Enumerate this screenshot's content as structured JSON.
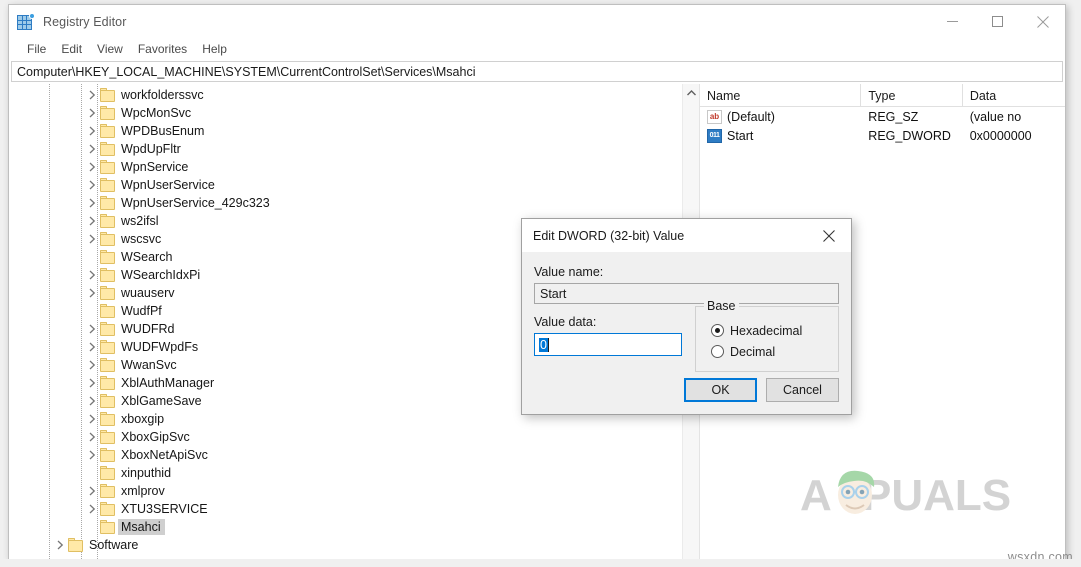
{
  "window": {
    "title": "Registry Editor",
    "icon": "registry-editor-icon",
    "minimize_label": "Minimize",
    "maximize_label": "Maximize",
    "close_label": "Close"
  },
  "menu": {
    "items": [
      {
        "label": "File"
      },
      {
        "label": "Edit"
      },
      {
        "label": "View"
      },
      {
        "label": "Favorites"
      },
      {
        "label": "Help"
      }
    ]
  },
  "address": {
    "value": "Computer\\HKEY_LOCAL_MACHINE\\SYSTEM\\CurrentControlSet\\Services\\Msahci"
  },
  "tree": {
    "items": [
      {
        "label": "workfolderssvc",
        "expandable": true,
        "indent": 1,
        "selected": false
      },
      {
        "label": "WpcMonSvc",
        "expandable": true,
        "indent": 1,
        "selected": false
      },
      {
        "label": "WPDBusEnum",
        "expandable": true,
        "indent": 1,
        "selected": false
      },
      {
        "label": "WpdUpFltr",
        "expandable": true,
        "indent": 1,
        "selected": false
      },
      {
        "label": "WpnService",
        "expandable": true,
        "indent": 1,
        "selected": false
      },
      {
        "label": "WpnUserService",
        "expandable": true,
        "indent": 1,
        "selected": false
      },
      {
        "label": "WpnUserService_429c323",
        "expandable": true,
        "indent": 1,
        "selected": false
      },
      {
        "label": "ws2ifsl",
        "expandable": true,
        "indent": 1,
        "selected": false
      },
      {
        "label": "wscsvc",
        "expandable": true,
        "indent": 1,
        "selected": false
      },
      {
        "label": "WSearch",
        "expandable": false,
        "indent": 1,
        "selected": false
      },
      {
        "label": "WSearchIdxPi",
        "expandable": true,
        "indent": 1,
        "selected": false
      },
      {
        "label": "wuauserv",
        "expandable": true,
        "indent": 1,
        "selected": false
      },
      {
        "label": "WudfPf",
        "expandable": false,
        "indent": 1,
        "selected": false
      },
      {
        "label": "WUDFRd",
        "expandable": true,
        "indent": 1,
        "selected": false
      },
      {
        "label": "WUDFWpdFs",
        "expandable": true,
        "indent": 1,
        "selected": false
      },
      {
        "label": "WwanSvc",
        "expandable": true,
        "indent": 1,
        "selected": false
      },
      {
        "label": "XblAuthManager",
        "expandable": true,
        "indent": 1,
        "selected": false
      },
      {
        "label": "XblGameSave",
        "expandable": true,
        "indent": 1,
        "selected": false
      },
      {
        "label": "xboxgip",
        "expandable": true,
        "indent": 1,
        "selected": false
      },
      {
        "label": "XboxGipSvc",
        "expandable": true,
        "indent": 1,
        "selected": false
      },
      {
        "label": "XboxNetApiSvc",
        "expandable": true,
        "indent": 1,
        "selected": false
      },
      {
        "label": "xinputhid",
        "expandable": false,
        "indent": 1,
        "selected": false
      },
      {
        "label": "xmlprov",
        "expandable": true,
        "indent": 1,
        "selected": false
      },
      {
        "label": "XTU3SERVICE",
        "expandable": true,
        "indent": 1,
        "selected": false
      },
      {
        "label": "Msahci",
        "expandable": false,
        "indent": 1,
        "selected": true
      },
      {
        "label": "Software",
        "expandable": true,
        "indent": 0,
        "selected": false
      }
    ]
  },
  "list": {
    "columns": [
      {
        "label": "Name"
      },
      {
        "label": "Type"
      },
      {
        "label": "Data"
      }
    ],
    "rows": [
      {
        "icon": "string-value-icon",
        "name": "(Default)",
        "type": "REG_SZ",
        "data": "(value no"
      },
      {
        "icon": "dword-value-icon",
        "name": "Start",
        "type": "REG_DWORD",
        "data": "0x0000000"
      }
    ]
  },
  "dialog": {
    "title": "Edit DWORD (32-bit) Value",
    "close_label": "Close",
    "value_name_label": "Value name:",
    "value_name": "Start",
    "value_data_label": "Value data:",
    "value_data": "0",
    "base_legend": "Base",
    "base_options": [
      {
        "label": "Hexadecimal",
        "selected": true
      },
      {
        "label": "Decimal",
        "selected": false
      }
    ],
    "ok_label": "OK",
    "cancel_label": "Cancel"
  },
  "watermarks": {
    "brand": "APPUALS",
    "site": "wsxdn.com"
  },
  "colors": {
    "accent": "#0078d7",
    "folder": "#ffe9a8",
    "selection": "#cfcfcf"
  }
}
